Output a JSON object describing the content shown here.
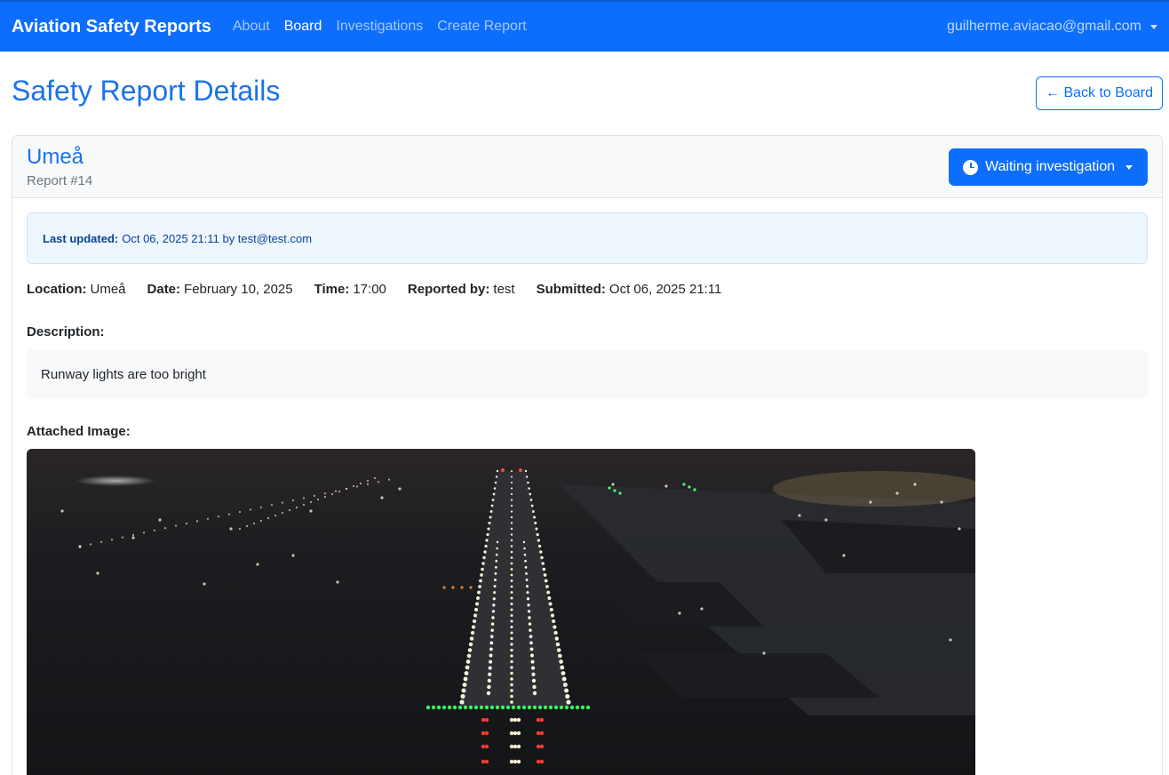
{
  "nav": {
    "brand": "Aviation Safety Reports",
    "links": [
      "About",
      "Board",
      "Investigations",
      "Create Report"
    ],
    "user": "guilherme.aviacao@gmail.com"
  },
  "page": {
    "title": "Safety Report Details",
    "back_label": "← Back to Board"
  },
  "report": {
    "name": "Umeå",
    "number": "Report #14",
    "status": "Waiting investigation",
    "last_updated_label": "Last updated:",
    "last_updated_value": "Oct 06, 2025 21:11 by test@test.com",
    "meta": [
      {
        "label": "Location:",
        "value": "Umeå"
      },
      {
        "label": "Date:",
        "value": "February 10, 2025"
      },
      {
        "label": "Time:",
        "value": "17:00"
      },
      {
        "label": "Reported by:",
        "value": "test"
      },
      {
        "label": "Submitted:",
        "value": "Oct 06, 2025 21:11"
      }
    ],
    "description_label": "Description:",
    "description": "Runway lights are too bright",
    "image_label": "Attached Image:"
  }
}
